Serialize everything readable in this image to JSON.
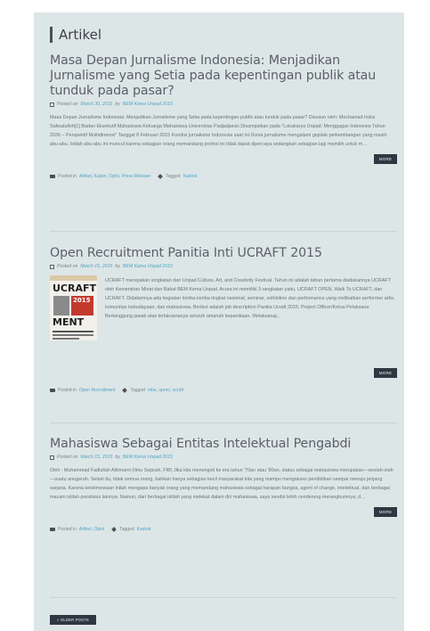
{
  "section": {
    "title": "Artikel"
  },
  "posts": [
    {
      "title": "Masa Depan Jurnalisme Indonesia: Menjadikan Jurnalisme yang Setia pada kepentingan publik atau tunduk pada pasar?",
      "posted_on_label": "Posted on",
      "date": "March 30, 2015",
      "by_label": "by",
      "author": "BEM Kema Unpad 2015",
      "excerpt": "Masa Depan Jurnalisme Indonesia: Menjadikan Jurnalisme yang Setia pada kepentingan publik atau tunduk pada pasar? Disusun oleh: Mochamad Indra Safwatulloh[1] Badan Eksekutif Mahasiswa Keluarga Mahasiswa Universitas Padjadjaran Disampaikan pada \"Lokakarya Unpad: Menggagas Indonesia Tahun 2030 – Perspektif Multidimensi\" Tanggal 8 Februari 2015 Kondisi jurnalisme Indonesia saat ini Dunia jurnalisme mengalami gejolak perkembangan yang masih abu-abu. Istilah abu-abu ini muncul karena sebagian orang memandang profesi ini tidak dapat dipercaya sedangkan sebagian lagi memilih untuk m…",
      "more_label": "MORE",
      "posted_in_label": "Posted in",
      "categories": "Artikel, Kajian, Opini, Press Release",
      "tagged_label": "Tagged",
      "tags": "Kastrat"
    },
    {
      "title": "Open Recruitment Panitia Inti UCRAFT 2015",
      "posted_on_label": "Posted on",
      "date": "March 15, 2015",
      "by_label": "by",
      "author": "BEM Kema Unpad 2015",
      "excerpt": "UCRAFT merupakan singkatan dari Unpad Culture, Art, and Creativity Festival. Tahun ini adalah tahun pertama diadakannya UCRAFT oleh Kementrian Minat dan Bakat BEM Kema Unpad. Acara ini memiliki 3 rangkaian yaitu, UCRAFT OPEN, Walk To UCRAFT, dan UCRAFT. Didalamnya ada kegiatan lomba-lomba tingkat nasional, seminar, exhibition dan performance yang melibatkan performer artis, komunitas kebudayaan, dan mahasiswa. Berikut adalah job description Panitia Ucraft 2015: Project Officer/Ketua Pelaksana Bertanggung jawab atas terlaksananya seluruh amanah kepanitiaan. Melaksanaj…",
      "more_label": "MORE",
      "posted_in_label": "Posted in",
      "categories": "Open Recruitment",
      "tagged_label": "Tagged",
      "tags": "mba, oprec, ucraft"
    },
    {
      "title": "Mahasiswa Sebagai Entitas Intelektual Pengabdi",
      "posted_on_label": "Posted on",
      "date": "March 15, 2015",
      "by_label": "by",
      "author": "BEM Kema Unpad 2015",
      "excerpt": "Oleh : Muhammad Fadlullah Alkimami (Ilmu Sejarah, FIB) Jika kita menengok ke era tahun '70an atau '80an, status sebagai mahasiswa merupakan—seolah-olah—suatu anugerah. Selain itu, tidak semua orang, bahkan hanya sebagian kecil masyarakat kita yang mampu mengakses pendidikan sampai menuju jenjang sarjana. Karena keistimewaan inilah mengapa banyak orang yang memandang mahasiswa sebagai harapan bangsa, agent of change, intelektual, dan berbagai macam istilah prestisius lainnya. Namun, dari berbagai istilah yang melekat dalam diri mahasiswa, saya sendiri lebih cenderung merangkumnya, d…",
      "more_label": "MORE",
      "posted_in_label": "Posted in",
      "categories": "Artikel, Opini",
      "tagged_label": "Tagged",
      "tags": "Kastrat"
    }
  ],
  "pagination": {
    "older_label": "« OLDER POSTS"
  },
  "thumbnail": {
    "line1": "UCRAFT",
    "line2": "2015",
    "line3": "MENT"
  }
}
